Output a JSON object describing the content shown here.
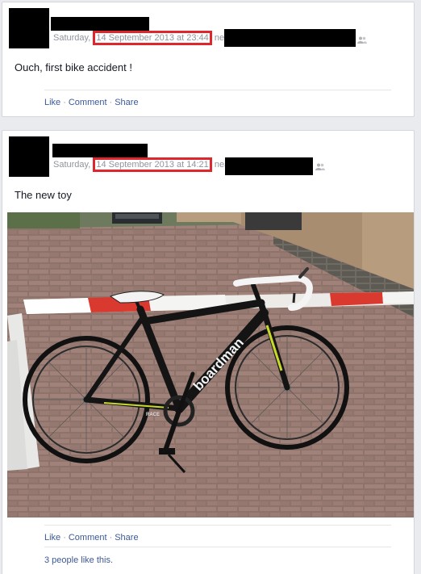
{
  "posts": [
    {
      "day": "Saturday, ",
      "timestamp": "14 September 2013 at 23:44",
      "near": " near",
      "text": "Ouch, first bike accident !",
      "actions": {
        "like": "Like",
        "comment": "Comment",
        "share": "Share"
      }
    },
    {
      "day": "Saturday, ",
      "timestamp": "14 September 2013 at 14:21",
      "near": " near",
      "text": "The new toy",
      "photo": {
        "frame_brand": "boardman",
        "decal": "RACE"
      },
      "actions": {
        "like": "Like",
        "comment": "Comment",
        "share": "Share"
      },
      "likes": "3 people like this."
    }
  ],
  "colors": {
    "link": "#3b5998",
    "highlight": "#e0262d",
    "meta": "#90949c"
  },
  "icons": {
    "audience": "friends-icon"
  }
}
